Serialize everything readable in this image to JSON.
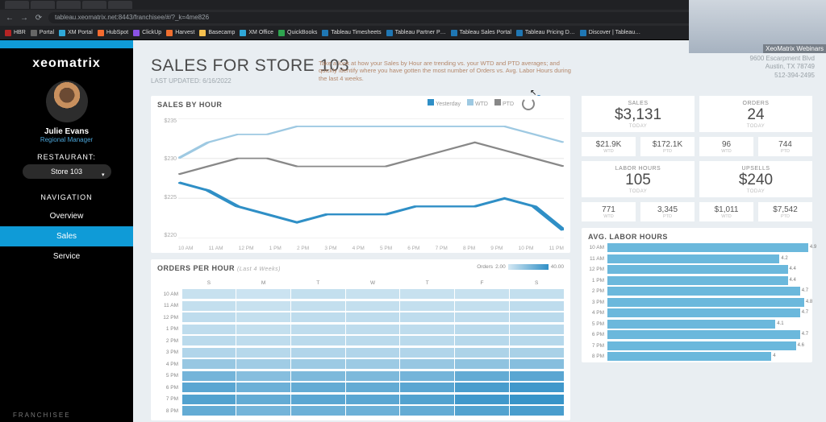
{
  "browser": {
    "url": "tableau.xeomatrix.net:8443/franchisee/#/?_k=4me826",
    "bookmarks": [
      {
        "label": "HBR",
        "color": "#b52424"
      },
      {
        "label": "Portal",
        "color": "#666"
      },
      {
        "label": "XM Portal",
        "color": "#2fa8d8"
      },
      {
        "label": "HubSpot",
        "color": "#f66b2f"
      },
      {
        "label": "ClickUp",
        "color": "#8a52e6"
      },
      {
        "label": "Harvest",
        "color": "#f06f2f"
      },
      {
        "label": "Basecamp",
        "color": "#f5c04e"
      },
      {
        "label": "XM Office",
        "color": "#2fa8d8"
      },
      {
        "label": "QuickBooks",
        "color": "#2ea44f"
      },
      {
        "label": "Tableau Timesheets",
        "color": "#1f77b4"
      },
      {
        "label": "Tableau Partner P…",
        "color": "#1f77b4"
      },
      {
        "label": "Tableau Sales Portal",
        "color": "#1f77b4"
      },
      {
        "label": "Tableau Pricing D…",
        "color": "#1f77b4"
      },
      {
        "label": "Discover | Tableau…",
        "color": "#1f77b4"
      }
    ]
  },
  "overlay": {
    "caption": "XeoMatrix Webinars"
  },
  "sidebar": {
    "brand": "xeomatrix",
    "user_name": "Julie Evans",
    "user_role": "Regional Manager",
    "restaurant_label": "RESTAURANT:",
    "store": "Store 103",
    "nav_label": "NAVIGATION",
    "nav": [
      {
        "label": "Overview",
        "active": false
      },
      {
        "label": "Sales",
        "active": true
      },
      {
        "label": "Service",
        "active": false
      }
    ],
    "footer": "FRANCHISEE"
  },
  "header": {
    "title": "SALES FOR STORE 103",
    "updated": "LAST UPDATED: 6/16/2022",
    "description": "Take a look at how your Sales by Hour are trending vs. your WTD and PTD averages; and quickly identify where you have gotten the most number of Orders vs. Avg. Labor Hours during the last 4 weeks.",
    "addr1": "9600 Escarpment Blvd",
    "addr2": "Austin, TX 78749",
    "addr3": "512-394-2495"
  },
  "line_chart": {
    "title": "SALES BY HOUR",
    "legend": [
      {
        "label": "Yesterday",
        "color": "#2f8fc6"
      },
      {
        "label": "WTD",
        "color": "#9ec9e2"
      },
      {
        "label": "PTD",
        "color": "#888888"
      }
    ],
    "y_ticks": [
      "$235",
      "$230",
      "$225",
      "$220"
    ],
    "x_ticks": [
      "10 AM",
      "11 AM",
      "12 PM",
      "1 PM",
      "2 PM",
      "3 PM",
      "4 PM",
      "5 PM",
      "6 PM",
      "7 PM",
      "8 PM",
      "9 PM",
      "10 PM",
      "11 PM"
    ]
  },
  "kpi": {
    "big": [
      {
        "label": "SALES",
        "value": "$3,131",
        "sub": "TODAY"
      },
      {
        "label": "ORDERS",
        "value": "24",
        "sub": "TODAY"
      },
      {
        "label": "LABOR HOURS",
        "value": "105",
        "sub": "TODAY"
      },
      {
        "label": "UPSELLS",
        "value": "$240",
        "sub": "TODAY"
      }
    ],
    "small": [
      [
        {
          "v": "$21.9K",
          "s": "WTD"
        },
        {
          "v": "$172.1K",
          "s": "PTD"
        }
      ],
      [
        {
          "v": "96",
          "s": "WTD"
        },
        {
          "v": "744",
          "s": "PTD"
        }
      ],
      [
        {
          "v": "771",
          "s": "WTD"
        },
        {
          "v": "3,345",
          "s": "PTD"
        }
      ],
      [
        {
          "v": "$1,011",
          "s": "WTD"
        },
        {
          "v": "$7,542",
          "s": "PTD"
        }
      ]
    ]
  },
  "heatmap": {
    "title": "ORDERS PER HOUR",
    "subtitle": "(Last 4 Weeks)",
    "measure": "Orders",
    "scale_min": "2.00",
    "scale_max": "40.00",
    "days": [
      "S",
      "M",
      "T",
      "W",
      "T",
      "F",
      "S"
    ],
    "hours": [
      "10 AM",
      "11 AM",
      "12 PM",
      "1 PM",
      "2 PM",
      "3 PM",
      "4 PM",
      "5 PM",
      "6 PM",
      "7 PM",
      "8 PM"
    ]
  },
  "avg_labor": {
    "title": "AVG. LABOR HOURS",
    "rows": [
      {
        "h": "10 AM",
        "v": 4.9
      },
      {
        "h": "11 AM",
        "v": 4.2
      },
      {
        "h": "12 PM",
        "v": 4.4
      },
      {
        "h": "1 PM",
        "v": 4.4
      },
      {
        "h": "2 PM",
        "v": 4.7
      },
      {
        "h": "3 PM",
        "v": 4.8
      },
      {
        "h": "4 PM",
        "v": 4.7
      },
      {
        "h": "5 PM",
        "v": 4.1
      },
      {
        "h": "6 PM",
        "v": 4.7
      },
      {
        "h": "7 PM",
        "v": 4.6
      },
      {
        "h": "8 PM",
        "v": 4.0
      }
    ],
    "max": 5.0
  },
  "chart_data": [
    {
      "type": "line",
      "title": "SALES BY HOUR",
      "xlabel": "",
      "ylabel": "$",
      "ylim": [
        220,
        235
      ],
      "categories": [
        "10 AM",
        "11 AM",
        "12 PM",
        "1 PM",
        "2 PM",
        "3 PM",
        "4 PM",
        "5 PM",
        "6 PM",
        "7 PM",
        "8 PM",
        "9 PM",
        "10 PM",
        "11 PM"
      ],
      "series": [
        {
          "name": "Yesterday",
          "color": "#2f8fc6",
          "values": [
            227,
            226,
            224,
            223,
            222,
            223,
            223,
            223,
            224,
            224,
            224,
            225,
            224,
            221
          ]
        },
        {
          "name": "WTD",
          "color": "#9ec9e2",
          "values": [
            230,
            232,
            233,
            233,
            234,
            234,
            234,
            234,
            234,
            234,
            234,
            234,
            233,
            232
          ]
        },
        {
          "name": "PTD",
          "color": "#888888",
          "values": [
            228,
            229,
            230,
            230,
            229,
            229,
            229,
            229,
            230,
            231,
            232,
            231,
            230,
            229
          ]
        }
      ]
    },
    {
      "type": "heatmap",
      "title": "ORDERS PER HOUR (Last 4 Weeks)",
      "rows": [
        "10 AM",
        "11 AM",
        "12 PM",
        "1 PM",
        "2 PM",
        "3 PM",
        "4 PM",
        "5 PM",
        "6 PM",
        "7 PM",
        "8 PM"
      ],
      "cols": [
        "S",
        "M",
        "T",
        "W",
        "T",
        "F",
        "S"
      ],
      "scale": [
        2,
        40
      ],
      "values": [
        [
          5,
          4,
          6,
          5,
          5,
          5,
          6
        ],
        [
          6,
          5,
          6,
          6,
          6,
          6,
          7
        ],
        [
          7,
          6,
          7,
          7,
          7,
          7,
          8
        ],
        [
          7,
          6,
          7,
          7,
          7,
          8,
          8
        ],
        [
          8,
          7,
          8,
          8,
          8,
          9,
          9
        ],
        [
          10,
          9,
          10,
          10,
          10,
          11,
          12
        ],
        [
          16,
          14,
          15,
          15,
          16,
          18,
          20
        ],
        [
          24,
          20,
          22,
          22,
          24,
          28,
          30
        ],
        [
          30,
          26,
          28,
          28,
          30,
          34,
          36
        ],
        [
          32,
          28,
          30,
          30,
          32,
          36,
          38
        ],
        [
          28,
          24,
          26,
          26,
          28,
          32,
          34
        ]
      ]
    },
    {
      "type": "bar",
      "orientation": "horizontal",
      "title": "AVG. LABOR HOURS",
      "categories": [
        "10 AM",
        "11 AM",
        "12 PM",
        "1 PM",
        "2 PM",
        "3 PM",
        "4 PM",
        "5 PM",
        "6 PM",
        "7 PM",
        "8 PM"
      ],
      "values": [
        4.9,
        4.2,
        4.4,
        4.4,
        4.7,
        4.8,
        4.7,
        4.1,
        4.7,
        4.6,
        4.0
      ],
      "xlim": [
        0,
        5
      ]
    }
  ]
}
